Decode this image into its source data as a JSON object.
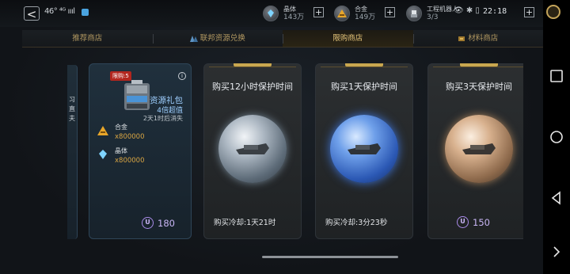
{
  "status_bar": {
    "signal_text": "46° ⁴ᴳ ıııl",
    "time": "22:18",
    "battery": "84",
    "misc_icons": "👁 ✱ ▯"
  },
  "resources": [
    {
      "name": "晶体",
      "amount": "143万"
    },
    {
      "name": "合金",
      "amount": "149万"
    },
    {
      "name": "工程机器人",
      "amount": "3/3"
    }
  ],
  "tabs": [
    {
      "label": "推荐商店",
      "active": false
    },
    {
      "label": "联邦资源兑换",
      "active": false
    },
    {
      "label": "限购商店",
      "active": true
    },
    {
      "label": "材料商店",
      "active": false
    }
  ],
  "edge_card_text": [
    "习",
    "直",
    "夫"
  ],
  "pack": {
    "limit_tag": "限购:5",
    "name": "资源礼包",
    "value_text": "4倍超值",
    "expire_text": "2天1时后消失",
    "items": [
      {
        "name": "合金",
        "qty": "x800000"
      },
      {
        "name": "晶体",
        "qty": "x800000"
      }
    ],
    "price": "180"
  },
  "protect_cards": [
    {
      "title": "购买12小时保护时间",
      "cooldown": "购买冷却:1天21时",
      "price": "",
      "orb": "silver"
    },
    {
      "title": "购买1天保护时间",
      "cooldown": "购买冷却:3分23秒",
      "price": "",
      "orb": "blue"
    },
    {
      "title": "购买3天保护时间",
      "cooldown": "",
      "price": "150",
      "orb": "gold"
    }
  ],
  "currency_symbol": "U",
  "info_symbol": "i",
  "plus_symbol": "+",
  "back_symbol": "<",
  "colors": {
    "gold_accent": "#e8c77b",
    "pack_text_blue": "#9ecfff",
    "price_purple": "#c9b6f5",
    "quantity_orange": "#d8a543"
  }
}
